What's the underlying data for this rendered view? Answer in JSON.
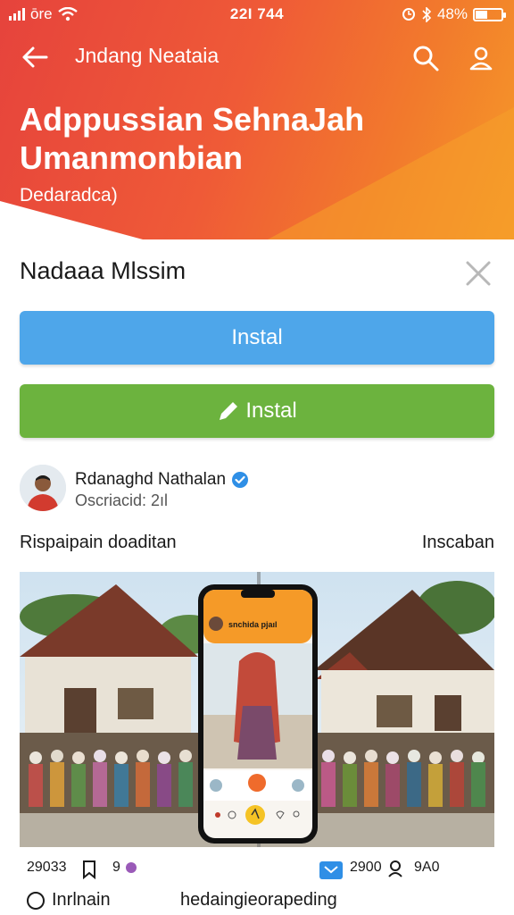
{
  "status_bar": {
    "carrier": "ōre",
    "time": "22I 744",
    "battery_percent": "48%",
    "battery_level": 0.48
  },
  "nav": {
    "title": "Jndang Neataia"
  },
  "hero": {
    "title": "Adppussian SehnaJah Umanmonbian",
    "subtitle": "Dedaradca)"
  },
  "sheet": {
    "title": "Nadaaa Mlssim"
  },
  "buttons": {
    "install_primary": "Instal",
    "install_secondary": "Instal"
  },
  "author": {
    "name": "Rdanaghd Nathalan",
    "meta": "Oscriacid: 2ıl"
  },
  "section": {
    "left_label": "Rispaipain doaditan",
    "right_label": "Inscaban"
  },
  "phone_mock": {
    "header": "snchida pjaıl"
  },
  "stats": {
    "count_a": "29033",
    "count_b": "9",
    "count_c": "2900",
    "count_d": "9A0"
  },
  "bottom": {
    "option_label": "Inrlnain",
    "text": "hedaingieorapeding"
  },
  "colors": {
    "hero_start": "#e6433c",
    "hero_end": "#f59a28",
    "button_blue": "#4ea6ea",
    "button_green": "#6cb33e",
    "verified": "#2f8fe6"
  },
  "icons": [
    "back-arrow-icon",
    "search-icon",
    "user-icon",
    "close-icon",
    "pencil-icon",
    "verified-icon",
    "wifi-icon",
    "signal-icon",
    "battery-icon",
    "bluetooth-icon",
    "alarm-icon",
    "bookmark-icon",
    "heart-icon",
    "comment-icon",
    "profile-icon"
  ]
}
